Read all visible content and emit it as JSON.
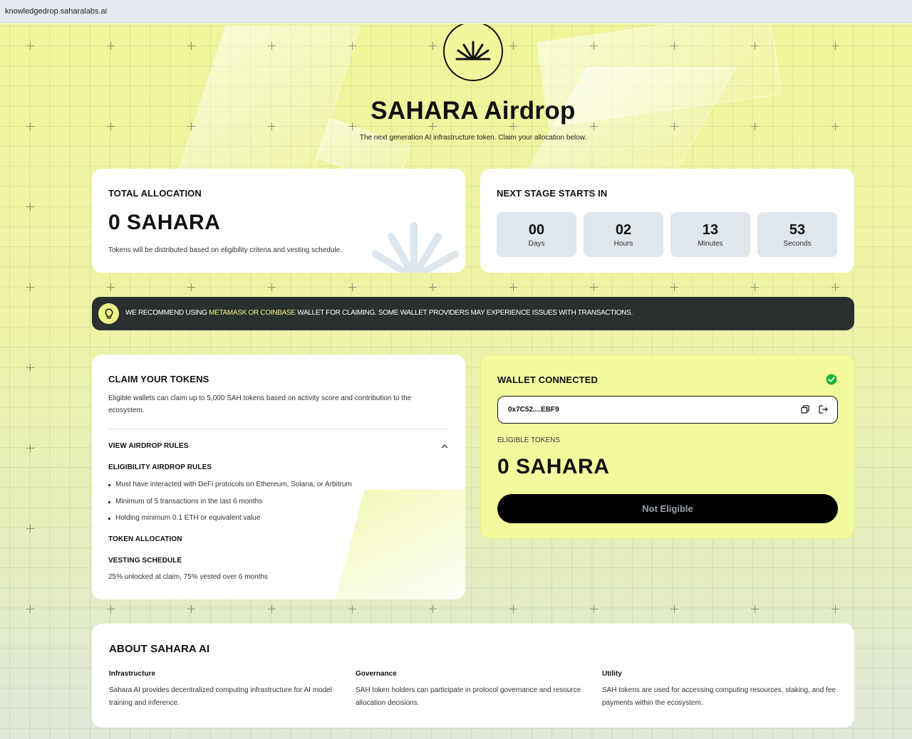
{
  "browser": {
    "url": "knowledgedrop.saharalabs.ai"
  },
  "header": {
    "title": "SAHARA Airdrop",
    "subtitle": "The next generation AI infrastructure token. Claim your allocation below."
  },
  "allocation": {
    "label": "TOTAL ALLOCATION",
    "amount": "0 SAHARA",
    "note": "Tokens will be distributed based on eligibility criteria and vesting schedule."
  },
  "countdown": {
    "label": "NEXT STAGE STARTS IN",
    "units": [
      {
        "value": "00",
        "unit": "Days"
      },
      {
        "value": "02",
        "unit": "Hours"
      },
      {
        "value": "13",
        "unit": "Minutes"
      },
      {
        "value": "53",
        "unit": "Seconds"
      }
    ]
  },
  "banner": {
    "prefix": "WE RECOMMEND USING ",
    "highlight": "METAMASK OR COINBASE",
    "suffix": " WALLET FOR CLAIMING. SOME WALLET PROVIDERS MAY EXPERIENCE ISSUES WITH TRANSACTIONS.",
    "highlight_color": "#eef486"
  },
  "claim": {
    "title": "CLAIM YOUR TOKENS",
    "description": "Eligible wallets can claim up to 5,000 SAH tokens based on activity score and contribution to the ecosystem.",
    "view_rules": "VIEW AIRDROP RULES",
    "eligibility_heading": "ELIGIBILITY AIRDROP RULES",
    "rules": [
      "Must have interacted with DeFi protocols on Ethereum, Solana, or Arbitrum",
      "Minimum of 5 transactions in the last 6 months",
      "Holding minimum 0.1 ETH or equivalent value"
    ],
    "token_allocation_heading": "TOKEN ALLOCATION",
    "vesting_heading": "VESTING SCHEDULE",
    "vesting_text": "25% unlocked at claim, 75% vested over 6 months"
  },
  "wallet": {
    "title": "WALLET CONNECTED",
    "address": "0x7C52....EBF9",
    "eligible_label": "ELIGIBLE TOKENS",
    "eligible_amount": "0 SAHARA",
    "button": "Not Eligible",
    "status_color": "#1fb53a",
    "card_color": "#f3fa9e"
  },
  "about": {
    "title": "ABOUT SAHARA AI",
    "columns": [
      {
        "heading": "Infrastructure",
        "text": "Sahara AI provides decentralized computing infrastructure for AI model training and inference."
      },
      {
        "heading": "Governance",
        "text": "SAH token holders can participate in protocol governance and resource allocation decisions."
      },
      {
        "heading": "Utility",
        "text": "SAH tokens are used for accessing computing resources, staking, and fee payments within the ecosystem."
      }
    ]
  },
  "icons": [
    "sahara-logo-icon",
    "lightbulb-icon",
    "check-circle-icon",
    "copy-icon",
    "logout-icon",
    "chevron-up-icon"
  ]
}
